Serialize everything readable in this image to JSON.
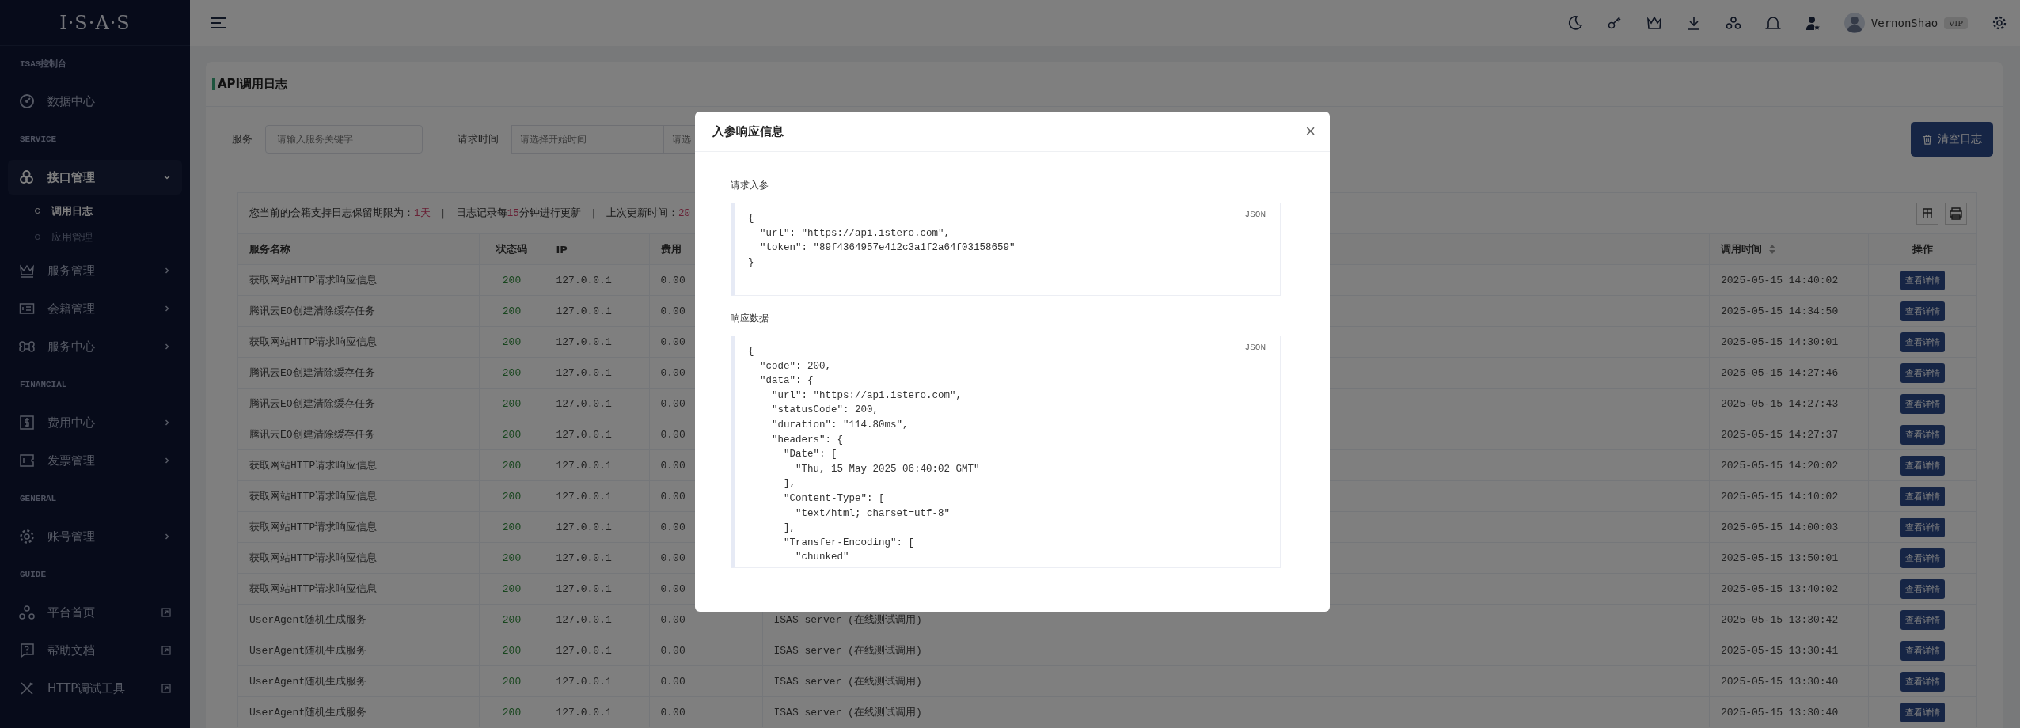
{
  "sidebar": {
    "logo": "I·S·A·S",
    "groups": [
      {
        "heading": "ISAS控制台",
        "items": [
          {
            "label": "数据中心",
            "kind": "plain",
            "selected": false
          }
        ]
      },
      {
        "heading": "SERVICE",
        "items": [
          {
            "label": "接口管理",
            "kind": "submenu",
            "selected": true,
            "expanded": true,
            "children": [
              {
                "label": "调用日志",
                "selected": true
              },
              {
                "label": "应用管理",
                "selected": false
              }
            ]
          },
          {
            "label": "服务管理",
            "kind": "submenu",
            "selected": false,
            "expanded": false
          },
          {
            "label": "会籍管理",
            "kind": "submenu",
            "selected": false,
            "expanded": false
          },
          {
            "label": "服务中心",
            "kind": "submenu",
            "selected": false,
            "expanded": false
          }
        ]
      },
      {
        "heading": "FINANCIAL",
        "items": [
          {
            "label": "费用中心",
            "kind": "submenu",
            "selected": false,
            "expanded": false
          },
          {
            "label": "发票管理",
            "kind": "submenu",
            "selected": false,
            "expanded": false
          }
        ]
      },
      {
        "heading": "GENERAL",
        "items": [
          {
            "label": "账号管理",
            "kind": "submenu",
            "selected": false,
            "expanded": false
          }
        ]
      },
      {
        "heading": "GUIDE",
        "items": [
          {
            "label": "平台首页",
            "kind": "external",
            "selected": false
          },
          {
            "label": "帮助文档",
            "kind": "external",
            "selected": false
          },
          {
            "label": "HTTP调试工具",
            "kind": "external",
            "selected": false
          }
        ]
      }
    ]
  },
  "topbar": {
    "user": {
      "name": "VernonShao",
      "badge": "VIP"
    }
  },
  "page": {
    "title": "API调用日志",
    "filters": [
      {
        "label": "服务",
        "placeholders": [
          "请输入服务关键字"
        ]
      },
      {
        "label": "请求时间",
        "placeholders": [
          "请选择开始时间",
          "请选"
        ]
      }
    ],
    "clear_button": "清空日志",
    "info": [
      {
        "kind": "text",
        "segments": [
          {
            "text": "您当前的会籍支持日志保留期限为：",
            "highlight": false
          },
          {
            "text": "1天",
            "highlight": true
          }
        ]
      },
      {
        "kind": "separator",
        "text": "|"
      },
      {
        "kind": "text",
        "segments": [
          {
            "text": "日志记录每",
            "highlight": false
          },
          {
            "text": "15",
            "highlight": true
          },
          {
            "text": "分钟进行更新",
            "highlight": false
          }
        ]
      },
      {
        "kind": "separator",
        "text": "|"
      },
      {
        "kind": "text",
        "segments": [
          {
            "text": "上次更新时间：",
            "highlight": false
          },
          {
            "text": "20",
            "highlight": true
          }
        ]
      }
    ],
    "table": {
      "columns": {
        "service": "服务名称",
        "status": "状态码",
        "ip": "IP",
        "fee": "费用",
        "time": "调用时间",
        "action": "操作"
      },
      "rows": [
        {
          "service": "获取网站HTTP请求响应信息",
          "status": "200",
          "ip": "127.0.0.1",
          "fee": "0.00",
          "time": "2025-05-15 14:40:02",
          "action": "查看详情"
        },
        {
          "service": "腾讯云EO创建清除缓存任务",
          "status": "200",
          "ip": "127.0.0.1",
          "fee": "0.00",
          "time": "2025-05-15 14:34:50",
          "action": "查看详情"
        },
        {
          "service": "获取网站HTTP请求响应信息",
          "status": "200",
          "ip": "127.0.0.1",
          "fee": "0.00",
          "time": "2025-05-15 14:30:01",
          "action": "查看详情"
        },
        {
          "service": "腾讯云EO创建清除缓存任务",
          "status": "200",
          "ip": "127.0.0.1",
          "fee": "0.00",
          "time": "2025-05-15 14:27:46",
          "action": "查看详情"
        },
        {
          "service": "腾讯云EO创建清除缓存任务",
          "status": "200",
          "ip": "127.0.0.1",
          "fee": "0.00",
          "time": "2025-05-15 14:27:43",
          "action": "查看详情"
        },
        {
          "service": "腾讯云EO创建清除缓存任务",
          "status": "200",
          "ip": "127.0.0.1",
          "fee": "0.00",
          "time": "2025-05-15 14:27:37",
          "action": "查看详情"
        },
        {
          "service": "获取网站HTTP请求响应信息",
          "status": "200",
          "ip": "127.0.0.1",
          "fee": "0.00",
          "time": "2025-05-15 14:20:02",
          "action": "查看详情"
        },
        {
          "service": "获取网站HTTP请求响应信息",
          "status": "200",
          "ip": "127.0.0.1",
          "fee": "0.00",
          "time": "2025-05-15 14:10:02",
          "action": "查看详情"
        },
        {
          "service": "获取网站HTTP请求响应信息",
          "status": "200",
          "ip": "127.0.0.1",
          "fee": "0.00",
          "time": "2025-05-15 14:00:03",
          "action": "查看详情"
        },
        {
          "service": "获取网站HTTP请求响应信息",
          "status": "200",
          "ip": "127.0.0.1",
          "fee": "0.00",
          "time": "2025-05-15 13:50:01",
          "action": "查看详情"
        },
        {
          "service": "获取网站HTTP请求响应信息",
          "status": "200",
          "ip": "127.0.0.1",
          "fee": "0.00",
          "time": "2025-05-15 13:40:02",
          "action": "查看详情"
        },
        {
          "service": "UserAgent随机生成服务",
          "status": "200",
          "ip": "127.0.0.1",
          "fee": "0.00",
          "column_5": "ISAS server (在线测试调用)",
          "time": "2025-05-15 13:30:42",
          "action": "查看详情"
        },
        {
          "service": "UserAgent随机生成服务",
          "status": "200",
          "ip": "127.0.0.1",
          "fee": "0.00",
          "column_5": "ISAS server (在线测试调用)",
          "time": "2025-05-15 13:30:41",
          "action": "查看详情"
        },
        {
          "service": "UserAgent随机生成服务",
          "status": "200",
          "ip": "127.0.0.1",
          "fee": "0.00",
          "column_5": "ISAS server (在线测试调用)",
          "time": "2025-05-15 13:30:40",
          "action": "查看详情"
        },
        {
          "service": "UserAgent随机生成服务",
          "status": "200",
          "ip": "127.0.0.1",
          "fee": "0.00",
          "column_5": "ISAS server (在线测试调用)",
          "time": "2025-05-15 13:30:40",
          "action": "查看详情"
        }
      ]
    }
  },
  "modal": {
    "title": "入参响应信息",
    "close": "×",
    "sections": [
      {
        "label": "请求入参",
        "language": "JSON",
        "code": "{\n  \"url\": \"https://api.istero.com\",\n  \"token\": \"89f4364957e412c3a1f2a64f03158659\"\n}"
      },
      {
        "label": "响应数据",
        "language": "JSON",
        "code": "{\n  \"code\": 200,\n  \"data\": {\n    \"url\": \"https://api.istero.com\",\n    \"statusCode\": 200,\n    \"duration\": \"114.80ms\",\n    \"headers\": {\n      \"Date\": [\n        \"Thu, 15 May 2025 06:40:02 GMT\"\n      ],\n      \"Content-Type\": [\n        \"text/html; charset=utf-8\"\n      ],\n      \"Transfer-Encoding\": [\n        \"chunked\""
      }
    ]
  }
}
